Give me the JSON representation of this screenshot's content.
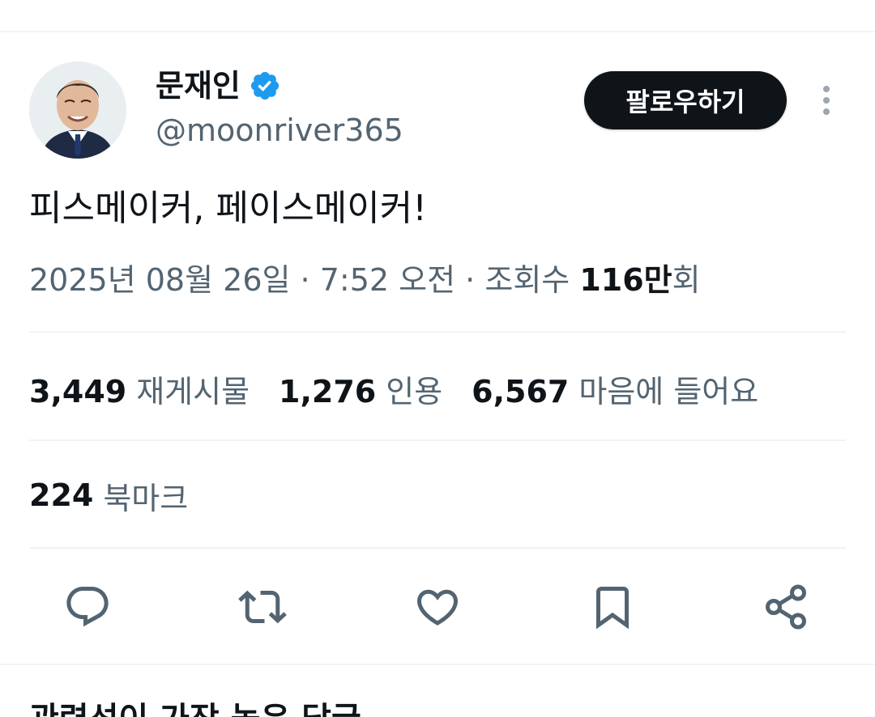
{
  "author": {
    "display_name": "문재인",
    "handle": "@moonriver365",
    "verified": true
  },
  "follow_label": "팔로우하기",
  "tweet": {
    "text": "피스메이커, 페이스메이커!",
    "date": "2025년 08월 26일",
    "separator": "·",
    "time": "7:52 오전",
    "views_label": "조회수",
    "views_count": "116만",
    "views_suffix": "회"
  },
  "stats": [
    {
      "count": "3,449",
      "label": "재게시물"
    },
    {
      "count": "1,276",
      "label": "인용"
    },
    {
      "count": "6,567",
      "label": "마음에 들어요"
    }
  ],
  "bookmarks": {
    "count": "224",
    "label": "북마크"
  },
  "actions": [
    "reply-icon",
    "repost-icon",
    "like-icon",
    "bookmark-icon",
    "share-icon"
  ],
  "next_section_heading": "관련성이 가장 높은 답글",
  "colors": {
    "text_primary": "#0f1419",
    "text_secondary": "#536471",
    "divider": "#eff3f4",
    "verified": "#1d9bf0",
    "button_bg": "#0f1419"
  }
}
